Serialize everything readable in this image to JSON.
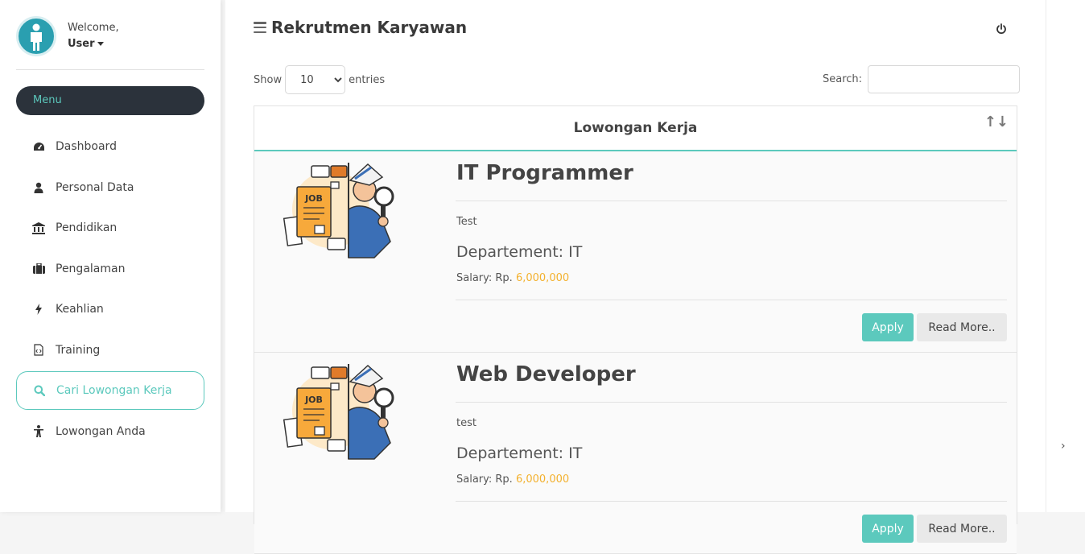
{
  "profile": {
    "welcome": "Welcome,",
    "user": "User"
  },
  "sidebar": {
    "menu_label": "Menu",
    "items": [
      {
        "label": "Dashboard",
        "icon": "dashboard-icon"
      },
      {
        "label": "Personal Data",
        "icon": "user-icon"
      },
      {
        "label": "Pendidikan",
        "icon": "institution-icon"
      },
      {
        "label": "Pengalaman",
        "icon": "briefcase-icon"
      },
      {
        "label": "Keahlian",
        "icon": "bolt-icon"
      },
      {
        "label": "Training",
        "icon": "file-code-icon"
      },
      {
        "label": "Cari Lowongan Kerja",
        "icon": "search-icon",
        "active": true
      },
      {
        "label": "Lowongan Anda",
        "icon": "person-icon"
      }
    ]
  },
  "header": {
    "title": "Rekrutmen Karyawan"
  },
  "table": {
    "show_label": "Show",
    "entries_value": "10",
    "entries_label": "entries",
    "search_label": "Search:",
    "column": "Lowongan Kerja",
    "sort_icon": "↑↓",
    "jobs": [
      {
        "title": "IT Programmer",
        "description": "Test",
        "department": "Departement: IT",
        "salary_label": "Salary: Rp.",
        "salary_value": "6,000,000",
        "apply": "Apply",
        "read_more": "Read More.."
      },
      {
        "title": "Web Developer",
        "description": "test",
        "department": "Departement: IT",
        "salary_label": "Salary: Rp.",
        "salary_value": "6,000,000",
        "apply": "Apply",
        "read_more": "Read More.."
      }
    ]
  },
  "colors": {
    "accent": "#5cc9bd",
    "dark": "#2b323b",
    "salary": "#f3b12e"
  },
  "rightbar": {
    "chevron": "›"
  }
}
